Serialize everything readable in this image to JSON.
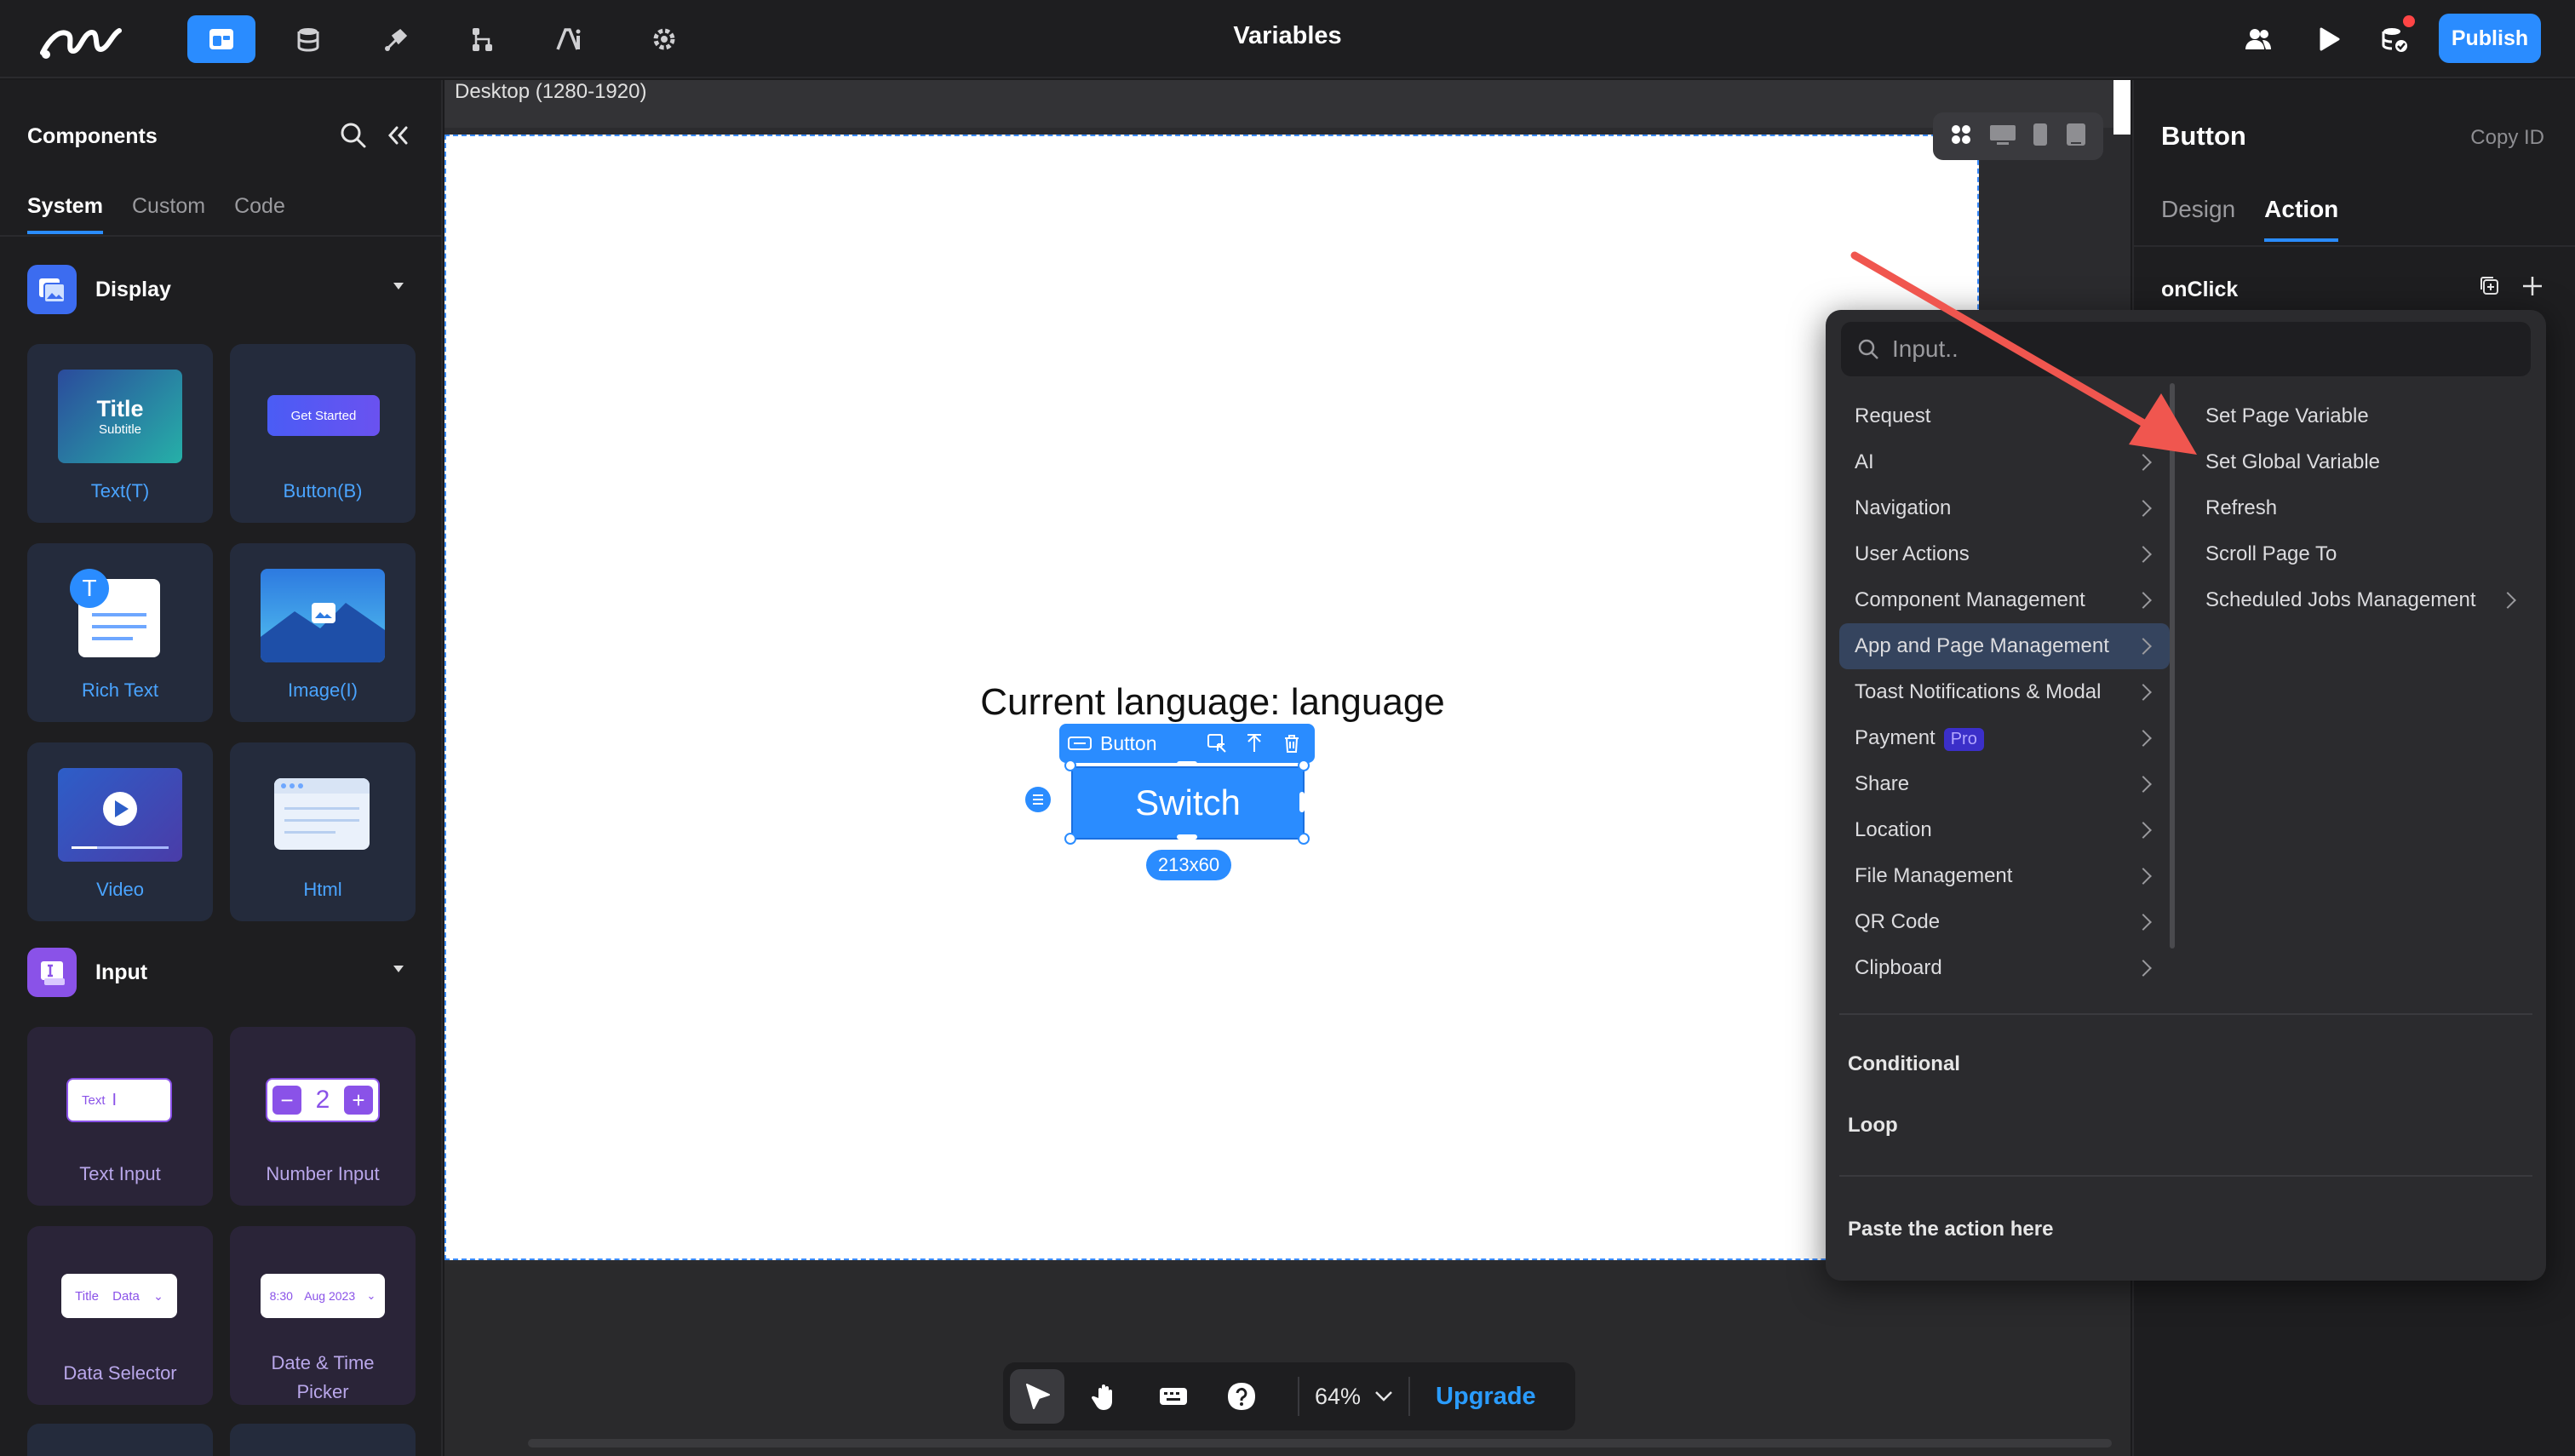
{
  "topbar": {
    "title": "Variables",
    "publish_label": "Publish",
    "nav_icons": [
      "pages-icon",
      "database-icon",
      "plugin-icon",
      "workflow-icon",
      "ai-icon",
      "settings-icon"
    ]
  },
  "left_panel": {
    "title": "Components",
    "tabs": [
      "System",
      "Custom",
      "Code"
    ],
    "sections": {
      "display": {
        "label": "Display"
      },
      "input": {
        "label": "Input"
      }
    },
    "cards": {
      "text": {
        "label": "Text(T)",
        "thumb_title": "Title",
        "thumb_subtitle": "Subtitle"
      },
      "button": {
        "label": "Button(B)",
        "thumb_text": "Get Started"
      },
      "rich_text": {
        "label": "Rich Text",
        "badge": "T"
      },
      "image": {
        "label": "Image(I)"
      },
      "video": {
        "label": "Video"
      },
      "html": {
        "label": "Html"
      },
      "text_input": {
        "label": "Text Input",
        "thumb_text": "Text"
      },
      "number_input": {
        "label": "Number Input",
        "thumb_value": "2"
      },
      "data_selector": {
        "label": "Data Selector",
        "thumb_title": "Title",
        "thumb_data": "Data"
      },
      "date_time": {
        "label": "Date & Time Picker",
        "thumb_time": "8:30",
        "thumb_date": "Aug 2023"
      }
    }
  },
  "canvas": {
    "device_label": "Desktop (1280-1920)",
    "text": "Current language: language",
    "selected_toolbar_label": "Button",
    "switch_label": "Switch",
    "size_label": "213x60",
    "zoom": "64%",
    "upgrade_label": "Upgrade"
  },
  "right_panel": {
    "title": "Button",
    "copy_id": "Copy ID",
    "tabs": [
      "Design",
      "Action"
    ],
    "event": "onClick"
  },
  "popup": {
    "search_placeholder": "Input..",
    "menu": [
      {
        "label": "Request"
      },
      {
        "label": "AI"
      },
      {
        "label": "Navigation"
      },
      {
        "label": "User Actions"
      },
      {
        "label": "Component Management"
      },
      {
        "label": "App and Page Management"
      },
      {
        "label": "Toast Notifications & Modal"
      },
      {
        "label": "Payment",
        "badge": "Pro"
      },
      {
        "label": "Share"
      },
      {
        "label": "Location"
      },
      {
        "label": "File Management"
      },
      {
        "label": "QR Code"
      },
      {
        "label": "Clipboard"
      }
    ],
    "submenu": [
      {
        "label": "Set Page Variable"
      },
      {
        "label": "Set Global Variable"
      },
      {
        "label": "Refresh"
      },
      {
        "label": "Scroll Page To"
      },
      {
        "label": "Scheduled Jobs Management"
      }
    ],
    "conditional": "Conditional",
    "loop": "Loop",
    "paste": "Paste the action here"
  },
  "colors": {
    "accent": "#2a8cff",
    "annotation_arrow": "#f0564f"
  }
}
